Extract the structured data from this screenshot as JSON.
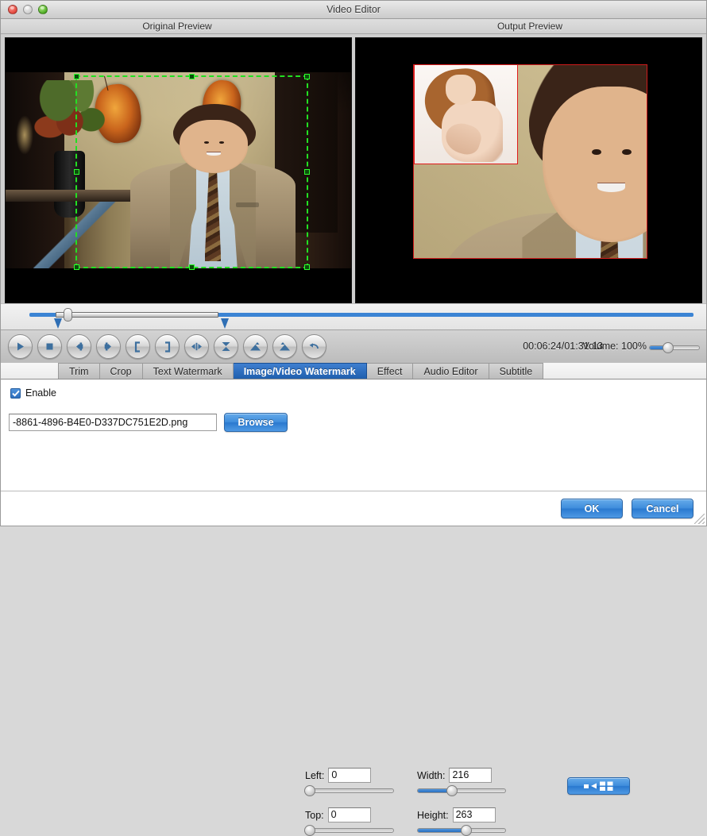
{
  "window": {
    "title": "Video Editor",
    "traffic_lights": [
      "close",
      "minimize",
      "zoom"
    ]
  },
  "previews": {
    "original_label": "Original Preview",
    "output_label": "Output Preview",
    "selection_color": "#22e022",
    "watermark_border_color": "#e01c1c"
  },
  "timeline": {
    "playhead_percent": 5.2,
    "trim_start_percent": 4,
    "trim_end_percent": 28.5
  },
  "toolbar": {
    "buttons": [
      {
        "name": "play-button",
        "icon": "play-icon"
      },
      {
        "name": "stop-button",
        "icon": "stop-icon"
      },
      {
        "name": "previous-frame-button",
        "icon": "prev-frame-icon"
      },
      {
        "name": "next-frame-button",
        "icon": "next-frame-icon"
      },
      {
        "name": "set-start-button",
        "icon": "bracket-left-icon"
      },
      {
        "name": "set-end-button",
        "icon": "bracket-right-icon"
      },
      {
        "name": "split-button",
        "icon": "split-icon"
      },
      {
        "name": "flip-vertical-button",
        "icon": "flip-vertical-icon"
      },
      {
        "name": "rotate-left-button",
        "icon": "rotate-left-icon"
      },
      {
        "name": "rotate-right-button",
        "icon": "rotate-right-icon"
      },
      {
        "name": "undo-button",
        "icon": "undo-icon"
      }
    ],
    "time_readout": "00:06:24/01:31:13",
    "current_time": "00:06:24",
    "total_time": "01:31:13",
    "volume_label": "Volume:",
    "volume_value": "100%",
    "volume_percent": 30
  },
  "tabs": [
    {
      "label": "Trim",
      "active": false
    },
    {
      "label": "Crop",
      "active": false
    },
    {
      "label": "Text Watermark",
      "active": false
    },
    {
      "label": "Image/Video Watermark",
      "active": true
    },
    {
      "label": "Effect",
      "active": false
    },
    {
      "label": "Audio Editor",
      "active": false
    },
    {
      "label": "Subtitle",
      "active": false
    }
  ],
  "panel": {
    "enable_label": "Enable",
    "enable_checked": true,
    "file_path": "-8861-4896-B4E0-D337DC751E2D.png",
    "browse_label": "Browse",
    "fields": [
      {
        "name": "left",
        "label": "Left:",
        "value": "0",
        "slider_percent": 0
      },
      {
        "name": "width",
        "label": "Width:",
        "value": "216",
        "slider_percent": 36
      },
      {
        "name": "top",
        "label": "Top:",
        "value": "0",
        "slider_percent": 0
      },
      {
        "name": "height",
        "label": "Height:",
        "value": "263",
        "slider_percent": 52
      }
    ],
    "apply_to_all_icon": "apply-to-all-icon"
  },
  "footer": {
    "ok_label": "OK",
    "cancel_label": "Cancel"
  },
  "colors": {
    "accent_blue": "#2f74c2",
    "tab_active": "#1f5fae",
    "selection_green": "#22e022",
    "watermark_red": "#e01c1c"
  }
}
